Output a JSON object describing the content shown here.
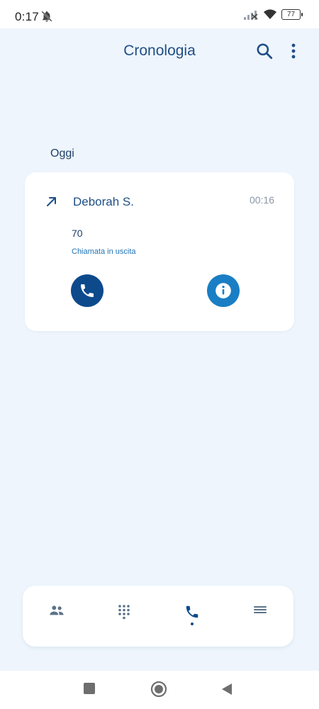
{
  "status_bar": {
    "time": "0:17",
    "battery": "77"
  },
  "header": {
    "title": "Cronologia"
  },
  "history": {
    "section_label": "Oggi",
    "entries": [
      {
        "name": "Deborah S.",
        "time": "00:16",
        "number": "70",
        "type": "Chiamata in uscita"
      }
    ]
  },
  "icons": {
    "outgoing": "arrow-up-right-icon",
    "call": "phone-icon",
    "info": "info-icon",
    "search": "search-icon",
    "more": "more-vert-icon",
    "contacts": "people-icon",
    "dialpad": "dialpad-icon",
    "recents": "phone-icon",
    "menu": "menu-icon"
  },
  "colors": {
    "background": "#eef5fd",
    "primary": "#0d4a8c",
    "accent": "#1a7ec4",
    "title": "#1f4f86"
  }
}
